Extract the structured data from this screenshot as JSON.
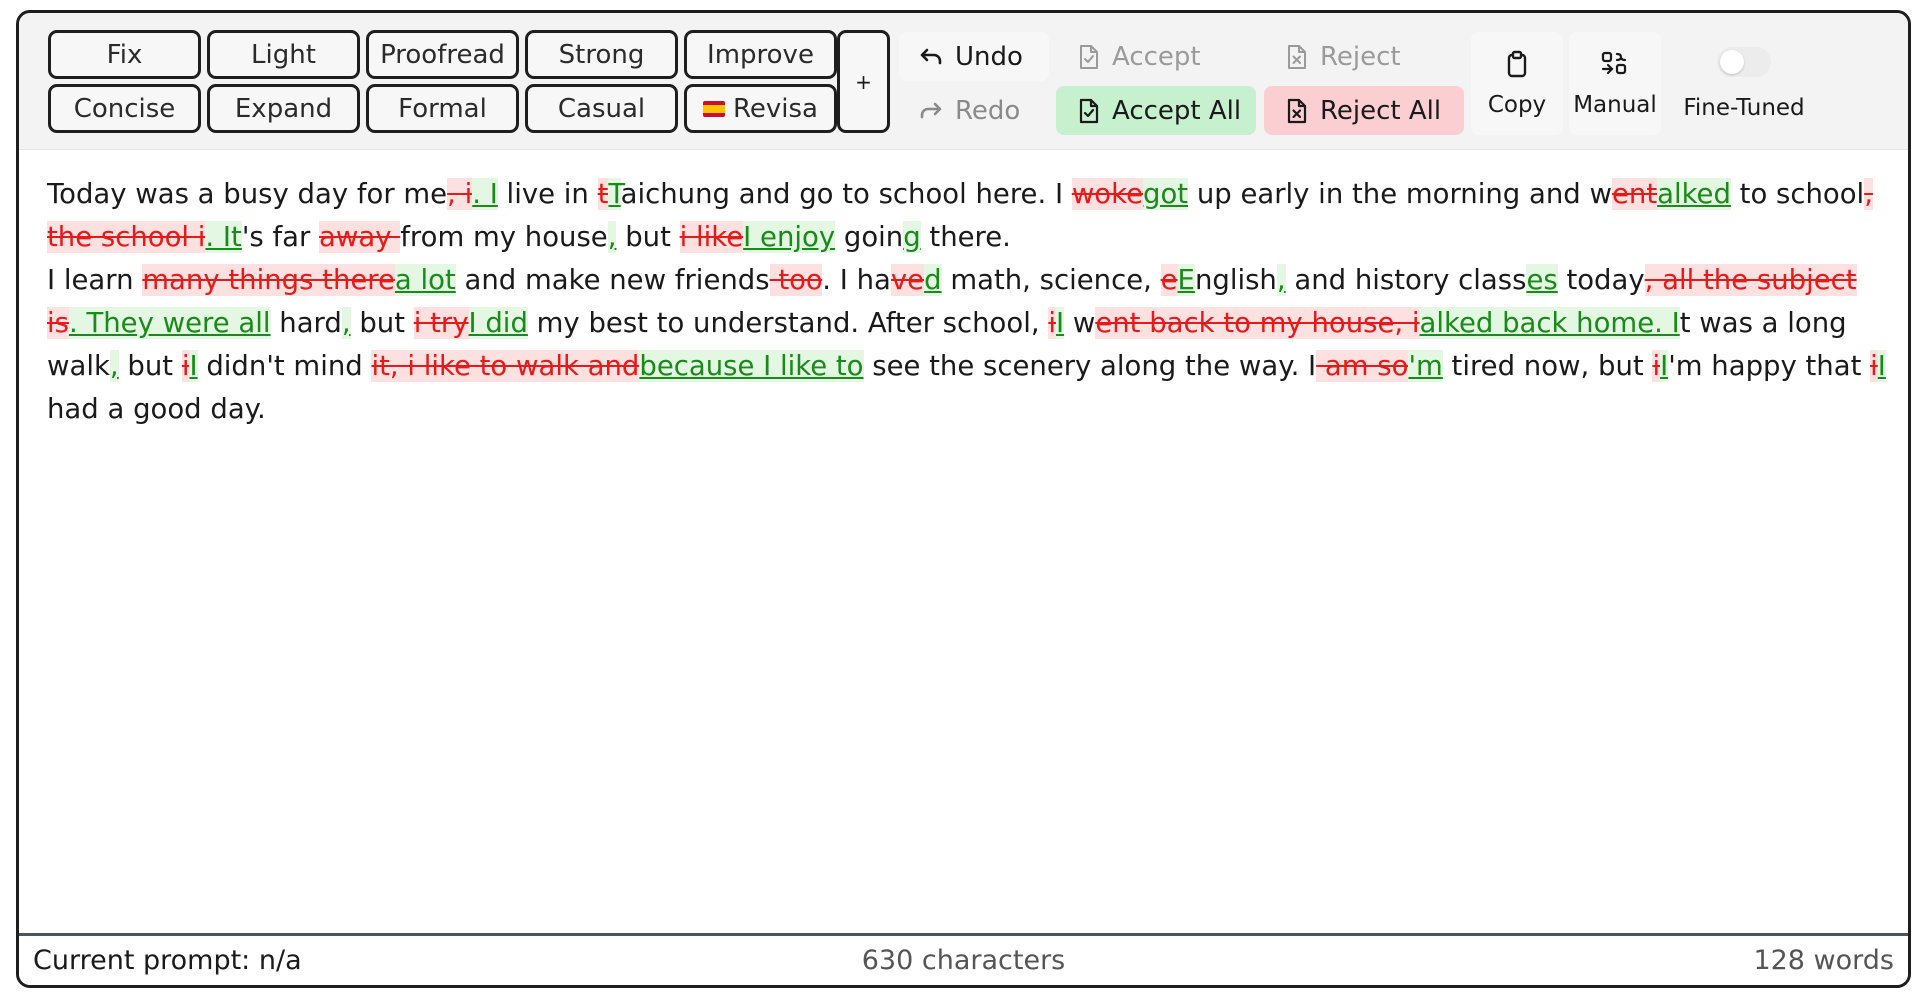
{
  "toolbar": {
    "prompts": [
      {
        "label": "Fix"
      },
      {
        "label": "Light"
      },
      {
        "label": "Proofread"
      },
      {
        "label": "Strong"
      },
      {
        "label": "Improve"
      },
      {
        "label": "Concise"
      },
      {
        "label": "Expand"
      },
      {
        "label": "Formal"
      },
      {
        "label": "Casual"
      },
      {
        "label": "Revisa"
      }
    ],
    "add_label": "+",
    "undo_label": "Undo",
    "redo_label": "Redo",
    "accept_label": "Accept",
    "reject_label": "Reject",
    "accept_all_label": "Accept All",
    "reject_all_label": "Reject All",
    "copy_label": "Copy",
    "manual_label": "Manual",
    "finetuned_label": "Fine-Tuned",
    "finetuned_on": false
  },
  "editor": {
    "paragraphs": [
      [
        [
          "t",
          "Today was a busy day for me"
        ],
        [
          "d",
          ", i"
        ],
        [
          "i",
          ". I"
        ],
        [
          "t",
          " live in "
        ],
        [
          "d",
          "t"
        ],
        [
          "i",
          "T"
        ],
        [
          "t",
          "aichung and go to school here. I "
        ],
        [
          "d",
          "woke"
        ],
        [
          "i",
          "got"
        ],
        [
          "t",
          " up early in the morning and w"
        ],
        [
          "d",
          "ent"
        ],
        [
          "i",
          "alked"
        ],
        [
          "t",
          " to school"
        ],
        [
          "d",
          ", the school i"
        ],
        [
          "i",
          ". It"
        ],
        [
          "t",
          "'s far "
        ],
        [
          "d",
          "away "
        ],
        [
          "t",
          "from my house"
        ],
        [
          "i",
          ","
        ],
        [
          "t",
          " but "
        ],
        [
          "d",
          "i like"
        ],
        [
          "i",
          "I enjoy"
        ],
        [
          "t",
          " goin"
        ],
        [
          "i",
          "g"
        ],
        [
          "t",
          " there."
        ]
      ],
      [
        [
          "t",
          "I learn "
        ],
        [
          "d",
          "many things there"
        ],
        [
          "i",
          "a lot"
        ],
        [
          "t",
          " and make new friends"
        ],
        [
          "d",
          " too"
        ],
        [
          "t",
          ". I ha"
        ],
        [
          "d",
          "ve"
        ],
        [
          "i",
          "d"
        ],
        [
          "t",
          " math, science, "
        ],
        [
          "d",
          "e"
        ],
        [
          "i",
          "E"
        ],
        [
          "t",
          "nglish"
        ],
        [
          "i",
          ","
        ],
        [
          "t",
          " and history class"
        ],
        [
          "i",
          "es"
        ],
        [
          "t",
          " today"
        ],
        [
          "d",
          ", all the subject is"
        ],
        [
          "i",
          ". They were all"
        ],
        [
          "t",
          " hard"
        ],
        [
          "i",
          ","
        ],
        [
          "t",
          " but "
        ],
        [
          "d",
          "i try"
        ],
        [
          "i",
          "I did"
        ],
        [
          "t",
          " my best to understand. After school, "
        ],
        [
          "d",
          "i"
        ],
        [
          "i",
          "I"
        ],
        [
          "t",
          " w"
        ],
        [
          "d",
          "ent back to my house, i"
        ],
        [
          "i",
          "alked back home. I"
        ],
        [
          "t",
          "t was a long walk"
        ],
        [
          "i",
          ","
        ],
        [
          "t",
          " but "
        ],
        [
          "d",
          "i"
        ],
        [
          "i",
          "I"
        ],
        [
          "t",
          " didn't mind "
        ],
        [
          "d",
          "it, i like to walk and"
        ],
        [
          "i",
          "because I like to"
        ],
        [
          "t",
          " see the scenery along the way. I"
        ],
        [
          "d",
          " am so"
        ],
        [
          "i",
          "'m"
        ],
        [
          "t",
          " tired now, but "
        ],
        [
          "d",
          "i"
        ],
        [
          "i",
          "I"
        ],
        [
          "t",
          "'m happy that "
        ],
        [
          "d",
          "i"
        ],
        [
          "i",
          "I"
        ],
        [
          "t",
          " had a good day."
        ]
      ]
    ]
  },
  "status": {
    "prompt": "Current prompt: n/a",
    "characters": "630 characters",
    "words": "128 words"
  },
  "colors": {
    "accept_all_bg": "#c7f0cf",
    "reject_all_bg": "#fbcfd2",
    "deletion": "#e51b1b",
    "insertion": "#1a8a1a"
  }
}
